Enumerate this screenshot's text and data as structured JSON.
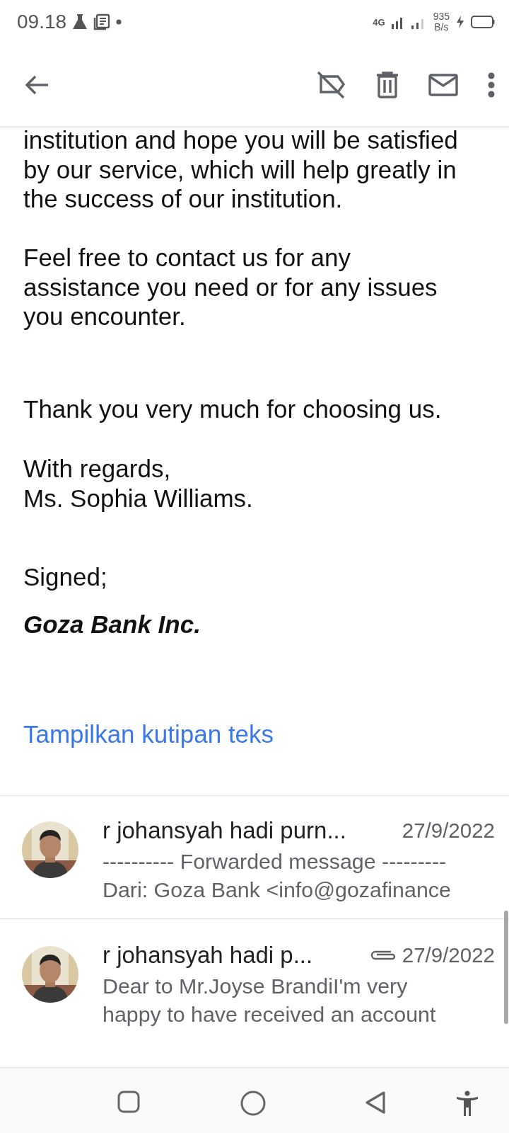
{
  "status_bar": {
    "time": "09.18",
    "network": "4G",
    "speed": "935",
    "speed_unit": "B/s"
  },
  "message": {
    "paragraphs": [
      {
        "kind": "text",
        "lines": [
          "institution and hope you will be satisfied",
          "by our service, which will help greatly in",
          "the success of our institution."
        ]
      },
      {
        "kind": "text",
        "lines": [
          "Feel free to contact us for any",
          "assistance you need or for any issues",
          "you encounter."
        ]
      },
      {
        "kind": "text",
        "lines": [
          "Thank you very much for choosing us."
        ]
      },
      {
        "kind": "text",
        "lines": [
          "With regards,",
          "Ms. Sophia Williams."
        ]
      },
      {
        "kind": "text",
        "lines": [
          "Signed;"
        ]
      },
      {
        "kind": "signature",
        "lines": [
          "Goza Bank Inc."
        ]
      },
      {
        "kind": "link",
        "lines": [
          "Tampilkan kutipan teks"
        ]
      }
    ]
  },
  "threads": [
    {
      "sender": "r johansyah hadi purn...",
      "date": "27/9/2022",
      "attachment": false,
      "snippet": [
        "---------- Forwarded message ---------",
        "Dari: Goza Bank <info@gozafinance"
      ]
    },
    {
      "sender": "r johansyah hadi p...",
      "date": "27/9/2022",
      "attachment": true,
      "snippet": [
        "Dear to Mr.Joyse BrandiI'm very",
        "happy to have received an account"
      ]
    }
  ]
}
